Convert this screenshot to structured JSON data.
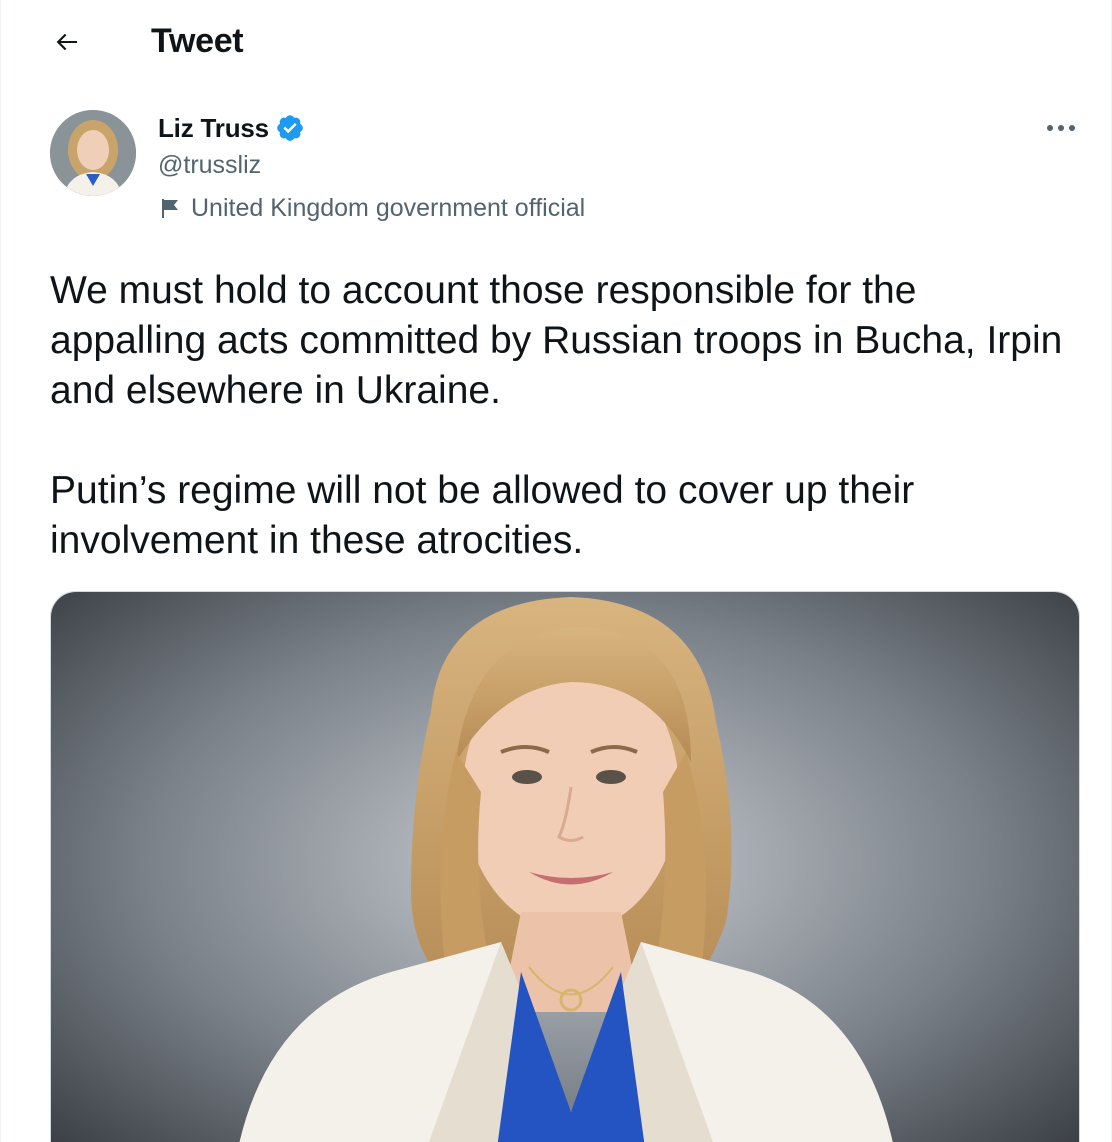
{
  "header": {
    "title": "Tweet",
    "back_icon": "arrow-left-icon"
  },
  "author": {
    "display_name": "Liz Truss",
    "handle": "@trussliz",
    "verified": true,
    "verified_color": "#1d9bf0",
    "label": "United Kingdom government official",
    "label_icon": "flag-icon"
  },
  "tweet": {
    "paragraphs": [
      "We must hold to account those responsible for the appalling acts committed by Russian troops in Bucha, Irpin and elsewhere in Ukraine.",
      "Putin’s regime will not be allowed to cover up their involvement in these atrocities."
    ]
  },
  "menu": {
    "icon": "more-options-icon"
  },
  "colors": {
    "text_primary": "#0f1419",
    "text_secondary": "#536471",
    "accent": "#1d9bf0",
    "border": "#cfd9de"
  }
}
